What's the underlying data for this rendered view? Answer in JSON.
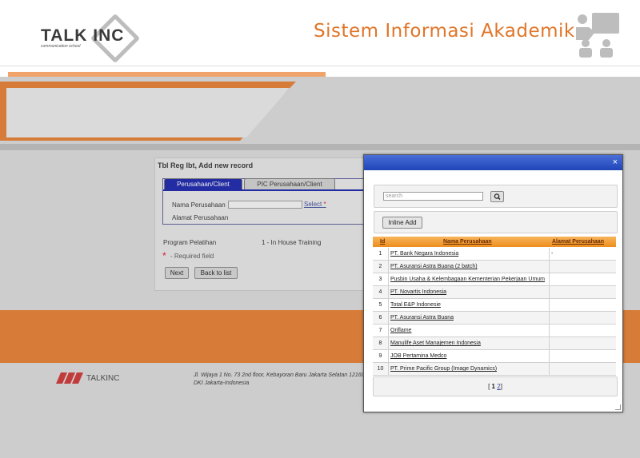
{
  "header": {
    "logo_text": "TALK INC",
    "logo_sub": "communication school",
    "title": "Sistem Informasi Akademik"
  },
  "form": {
    "title": "Tbl Reg Ibt, Add new record",
    "tabs": [
      "Perusahaan/Client",
      "PIC Perusahaan/Client"
    ],
    "fields": {
      "nama_label": "Nama Perusahaan",
      "nama_value": "",
      "select_link": "Select",
      "required_star": "*",
      "alamat_label": "Alamat Perusahaan"
    },
    "program_label": "Program Pelatihan",
    "program_value": "1 - In House Training",
    "required_note": "- Required field",
    "buttons": {
      "next": "Next",
      "back": "Back to list"
    }
  },
  "footer": {
    "brand": "TALKINC",
    "address_line1": "Jl. Wijaya 1 No. 73 2nd floor, Kebayoran Baru Jakarta Selatan 12160,",
    "address_line2": "DKI Jakarta-Indonesia"
  },
  "modal": {
    "close": "×",
    "search_placeholder": "search",
    "inline_add": "Inline Add",
    "columns": {
      "id": "Id",
      "name": "Nama Perusahaan",
      "address": "Alamat Perusahaan"
    },
    "rows": [
      {
        "id": "1",
        "name": "PT. Bank Negara Indonesia",
        "address": "-"
      },
      {
        "id": "2",
        "name": "PT. Asuransi Astra Buana (2 batch)",
        "address": ""
      },
      {
        "id": "3",
        "name": "Pusbin Usaha & Kelembagaan Kementerian Pekerjaan Umum",
        "address": ""
      },
      {
        "id": "4",
        "name": "PT. Novartis Indonesia",
        "address": ""
      },
      {
        "id": "5",
        "name": "Total E&P Indonesie",
        "address": ""
      },
      {
        "id": "6",
        "name": "PT. Asuransi Astra Buana",
        "address": ""
      },
      {
        "id": "7",
        "name": "Oriflame",
        "address": ""
      },
      {
        "id": "8",
        "name": "Manulife Aset Manajemen Indonesia",
        "address": ""
      },
      {
        "id": "9",
        "name": "JOB Pertamina Medco",
        "address": ""
      },
      {
        "id": "10",
        "name": "PT. Prime Pacific Group (Image Dynamics)",
        "address": ""
      }
    ],
    "pager": {
      "open": "[",
      "page1": "1",
      "page2": "2",
      "close": "]"
    }
  }
}
